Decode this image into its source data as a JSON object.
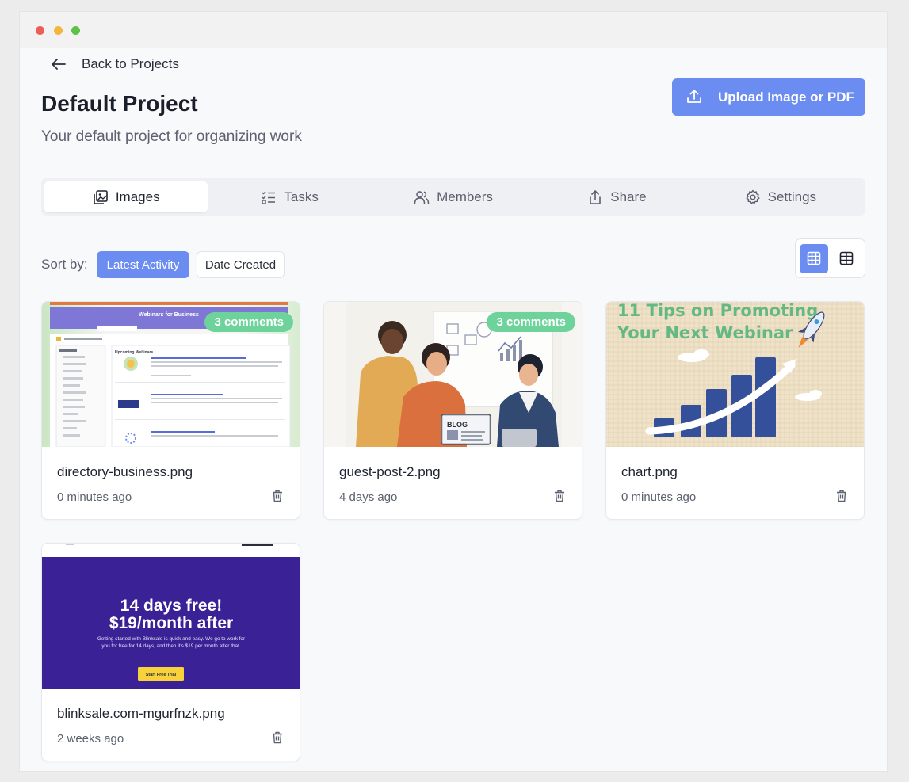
{
  "nav": {
    "back_label": "Back to Projects"
  },
  "project": {
    "title": "Default Project",
    "subtitle": "Your default project for organizing work"
  },
  "upload": {
    "label": "Upload Image or PDF"
  },
  "tabs": [
    {
      "label": "Images",
      "icon": "images-icon",
      "active": true
    },
    {
      "label": "Tasks",
      "icon": "tasks-icon",
      "active": false
    },
    {
      "label": "Members",
      "icon": "members-icon",
      "active": false
    },
    {
      "label": "Share",
      "icon": "share-icon",
      "active": false
    },
    {
      "label": "Settings",
      "icon": "gear-icon",
      "active": false
    }
  ],
  "sort": {
    "label": "Sort by:",
    "options": [
      "Latest Activity",
      "Date Created"
    ],
    "selected": "Latest Activity"
  },
  "view": {
    "selected": "grid",
    "options": [
      "grid",
      "table"
    ]
  },
  "cards": [
    {
      "name": "directory-business.png",
      "time": "0 minutes ago",
      "comments": "3 comments",
      "thumb": {
        "banner": "Webinars for Business",
        "heading": "Upcoming Webinars"
      }
    },
    {
      "name": "guest-post-2.png",
      "time": "4 days ago",
      "comments": "3 comments",
      "thumb": {
        "laptop_text": "BLOG"
      }
    },
    {
      "name": "chart.png",
      "time": "0 minutes ago",
      "comments": "",
      "thumb": {
        "line1": "11 Tips on Promoting",
        "line2": "Your Next Webinar"
      }
    },
    {
      "name": "blinksale.com-mgurfnzk.png",
      "time": "2 weeks ago",
      "comments": "",
      "thumb": {
        "line1": "14 days free!",
        "line2": "$19/month after",
        "body1": "Getting started with Blinksale is quick and easy. We go to work for",
        "body2": "you for free for 14 days, and then it's $19 per month after that.",
        "cta": "Start Free Trial"
      }
    }
  ],
  "colors": {
    "accent": "#6b8cf0",
    "badge": "#6dd39a",
    "promo_bg": "#3a2296",
    "promo_cta": "#f7d23a"
  }
}
